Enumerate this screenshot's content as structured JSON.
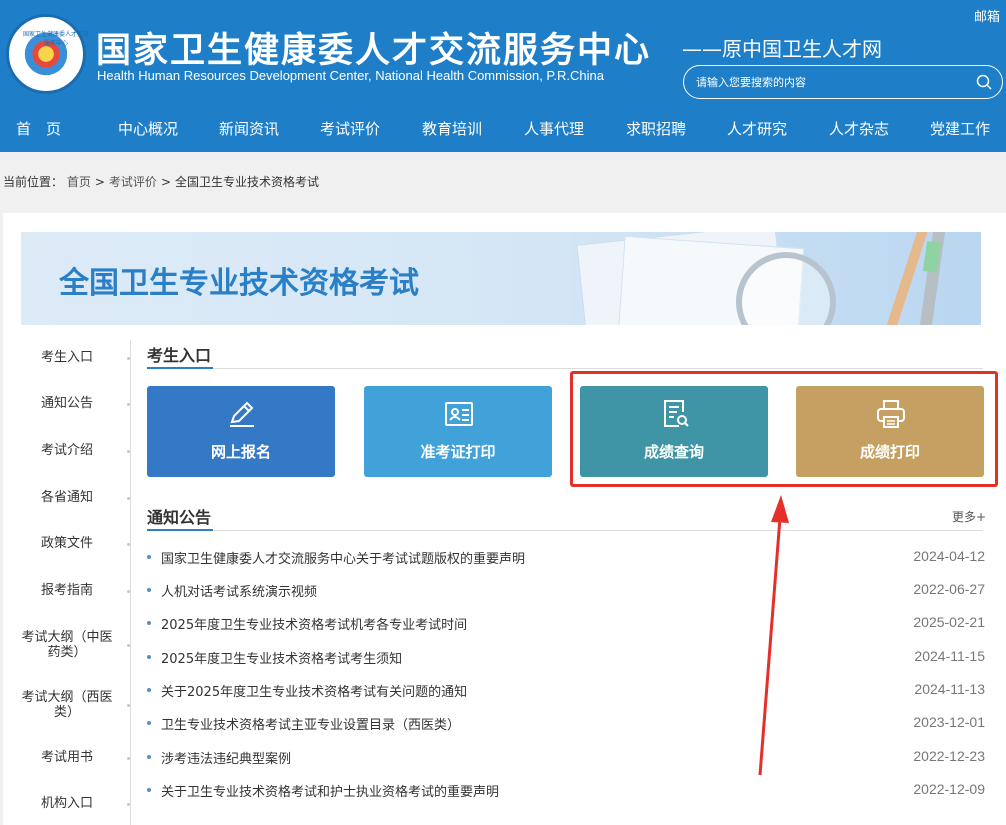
{
  "header": {
    "title_cn": "国家卫生健康委人才交流服务中心",
    "title_en": "Health Human Resources Development Center, National Health Commission, P.R.China",
    "subtitle": "——原中国卫生人才网",
    "mailbox": "邮箱",
    "search_placeholder": "请输入您要搜索的内容",
    "logo_text": "国家卫生健康委人才交流服务中心"
  },
  "nav": [
    "首　页",
    "中心概况",
    "新闻资讯",
    "考试评价",
    "教育培训",
    "人事代理",
    "求职招聘",
    "人才研究",
    "人才杂志",
    "党建工作"
  ],
  "breadcrumb": {
    "label": "当前位置：",
    "items": [
      "首页",
      "考试评价",
      "全国卫生专业技术资格考试"
    ]
  },
  "banner_title": "全国卫生专业技术资格考试",
  "sidebar": [
    "考生入口",
    "通知公告",
    "考试介绍",
    "各省通知",
    "政策文件",
    "报考指南",
    "考试大纲（中医药类）",
    "考试大纲（西医类）",
    "考试用书",
    "机构入口"
  ],
  "entry_section": "考生入口",
  "tiles": [
    {
      "label": "网上报名",
      "icon": "pen-icon",
      "color": "#3479c6"
    },
    {
      "label": "准考证打印",
      "icon": "id-card-icon",
      "color": "#41a2da"
    },
    {
      "label": "成绩查询",
      "icon": "doc-search-icon",
      "color": "#3f95a5"
    },
    {
      "label": "成绩打印",
      "icon": "printer-icon",
      "color": "#c6a062"
    }
  ],
  "notice_section": "通知公告",
  "more_label": "更多+",
  "notices": [
    {
      "title": "国家卫生健康委人才交流服务中心关于考试试题版权的重要声明",
      "date": "2024-04-12"
    },
    {
      "title": "人机对话考试系统演示视频",
      "date": "2022-06-27"
    },
    {
      "title": "2025年度卫生专业技术资格考试机考各专业考试时间",
      "date": "2025-02-21"
    },
    {
      "title": "2025年度卫生专业技术资格考试考生须知",
      "date": "2024-11-15"
    },
    {
      "title": "关于2025年度卫生专业技术资格考试有关问题的通知",
      "date": "2024-11-13"
    },
    {
      "title": "卫生专业技术资格考试主亚专业设置目录（西医类）",
      "date": "2023-12-01"
    },
    {
      "title": "涉考违法违纪典型案例",
      "date": "2022-12-23"
    },
    {
      "title": "关于卫生专业技术资格考试和护士执业资格考试的重要声明",
      "date": "2022-12-09"
    }
  ],
  "colors": {
    "header_bg": "#1e7fc8",
    "highlight": "#e5302a",
    "accent": "#2a7fc6"
  }
}
